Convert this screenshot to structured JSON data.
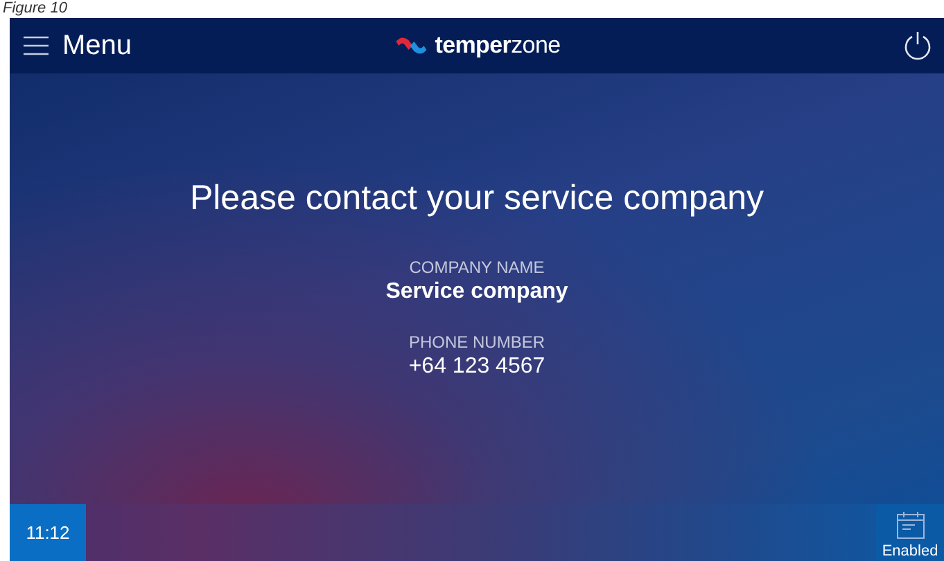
{
  "caption": "Figure 10",
  "top_bar": {
    "menu_label": "Menu",
    "logo": "**temper**zone"
  },
  "message": {
    "title": "Please contact your service company",
    "fields": [
      {
        "label": "COMPANY NAME",
        "value": "Service company",
        "kind": "bold"
      },
      {
        "label": "PHONE NUMBER",
        "value": "+64 123 4567",
        "kind": "normal"
      }
    ]
  },
  "bottom_bar": {
    "time": "11:12",
    "schedule_label": "Enabled"
  }
}
